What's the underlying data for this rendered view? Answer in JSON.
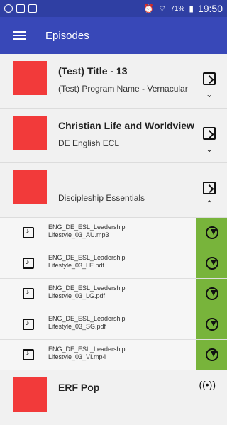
{
  "status_bar": {
    "battery": "71%",
    "time": "19:50"
  },
  "app_bar": {
    "title": "Episodes"
  },
  "cards": [
    {
      "title": "(Test) Title - 13",
      "subtitle": "(Test) Program Name - Vernacular",
      "chevron": "⌄"
    },
    {
      "title": "Christian Life and Worldview",
      "subtitle": "DE English ECL",
      "chevron": "⌄"
    },
    {
      "title": "",
      "subtitle": "Discipleship Essentials",
      "chevron": "⌃"
    }
  ],
  "files": [
    {
      "line1": "ENG_DE_ESL_Leadership",
      "line2": "Lifestyle_03_AU.mp3"
    },
    {
      "line1": "ENG_DE_ESL_Leadership",
      "line2": "Lifestyle_03_LE.pdf"
    },
    {
      "line1": "ENG_DE_ESL_Leadership",
      "line2": "Lifestyle_03_LG.pdf"
    },
    {
      "line1": "ENG_DE_ESL_Leadership",
      "line2": "Lifestyle_03_SG.pdf"
    },
    {
      "line1": "ENG_DE_ESL_Leadership",
      "line2": "Lifestyle_03_VI.mp4"
    }
  ],
  "last_card": {
    "title": "ERF Pop",
    "icon": "((•))"
  },
  "colors": {
    "status_bar": "#2f3fa3",
    "app_bar": "#3848b8",
    "thumbnail": "#f23a3a",
    "download": "#78b43b"
  }
}
